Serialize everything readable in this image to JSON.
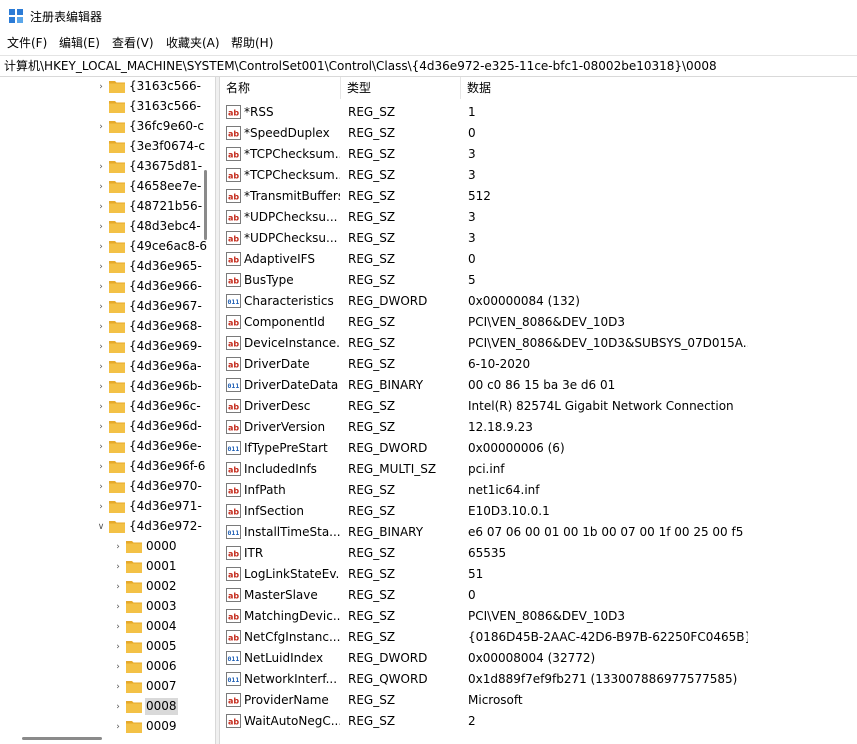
{
  "window": {
    "title": "注册表编辑器",
    "app_icon": "regedit-icon"
  },
  "menu": [
    "文件(F)",
    "编辑(E)",
    "查看(V)",
    "收藏夹(A)",
    "帮助(H)"
  ],
  "address": "计算机\\HKEY_LOCAL_MACHINE\\SYSTEM\\ControlSet001\\Control\\Class\\{4d36e972-e325-11ce-bfc1-08002be10318}\\0008",
  "tree": {
    "items": [
      {
        "label": "{3163c566-",
        "level": 1,
        "expander": "collapsed"
      },
      {
        "label": "{3163c566-",
        "level": 1,
        "expander": "none"
      },
      {
        "label": "{36fc9e60-c",
        "level": 1,
        "expander": "collapsed"
      },
      {
        "label": "{3e3f0674-c",
        "level": 1,
        "expander": "none"
      },
      {
        "label": "{43675d81-",
        "level": 1,
        "expander": "collapsed"
      },
      {
        "label": "{4658ee7e-",
        "level": 1,
        "expander": "collapsed"
      },
      {
        "label": "{48721b56-",
        "level": 1,
        "expander": "collapsed"
      },
      {
        "label": "{48d3ebc4-",
        "level": 1,
        "expander": "collapsed"
      },
      {
        "label": "{49ce6ac8-6",
        "level": 1,
        "expander": "collapsed"
      },
      {
        "label": "{4d36e965-",
        "level": 1,
        "expander": "collapsed"
      },
      {
        "label": "{4d36e966-",
        "level": 1,
        "expander": "collapsed"
      },
      {
        "label": "{4d36e967-",
        "level": 1,
        "expander": "collapsed"
      },
      {
        "label": "{4d36e968-",
        "level": 1,
        "expander": "collapsed"
      },
      {
        "label": "{4d36e969-",
        "level": 1,
        "expander": "collapsed"
      },
      {
        "label": "{4d36e96a-",
        "level": 1,
        "expander": "collapsed"
      },
      {
        "label": "{4d36e96b-",
        "level": 1,
        "expander": "collapsed"
      },
      {
        "label": "{4d36e96c-",
        "level": 1,
        "expander": "collapsed"
      },
      {
        "label": "{4d36e96d-",
        "level": 1,
        "expander": "collapsed"
      },
      {
        "label": "{4d36e96e-",
        "level": 1,
        "expander": "collapsed"
      },
      {
        "label": "{4d36e96f-6",
        "level": 1,
        "expander": "collapsed"
      },
      {
        "label": "{4d36e970-",
        "level": 1,
        "expander": "collapsed"
      },
      {
        "label": "{4d36e971-",
        "level": 1,
        "expander": "collapsed"
      },
      {
        "label": "{4d36e972-",
        "level": 1,
        "expander": "expanded"
      },
      {
        "label": "0000",
        "level": 2,
        "expander": "collapsed"
      },
      {
        "label": "0001",
        "level": 2,
        "expander": "collapsed"
      },
      {
        "label": "0002",
        "level": 2,
        "expander": "collapsed"
      },
      {
        "label": "0003",
        "level": 2,
        "expander": "collapsed"
      },
      {
        "label": "0004",
        "level": 2,
        "expander": "collapsed"
      },
      {
        "label": "0005",
        "level": 2,
        "expander": "collapsed"
      },
      {
        "label": "0006",
        "level": 2,
        "expander": "collapsed"
      },
      {
        "label": "0007",
        "level": 2,
        "expander": "collapsed"
      },
      {
        "label": "0008",
        "level": 2,
        "expander": "collapsed",
        "selected": true
      },
      {
        "label": "0009",
        "level": 2,
        "expander": "collapsed"
      }
    ]
  },
  "list": {
    "headers": {
      "name": "名称",
      "type": "类型",
      "data": "数据"
    },
    "rows": [
      {
        "icon": "string-value-icon",
        "name": "*RSS",
        "type": "REG_SZ",
        "data": "1"
      },
      {
        "icon": "string-value-icon",
        "name": "*SpeedDuplex",
        "type": "REG_SZ",
        "data": "0"
      },
      {
        "icon": "string-value-icon",
        "name": "*TCPChecksum...",
        "type": "REG_SZ",
        "data": "3"
      },
      {
        "icon": "string-value-icon",
        "name": "*TCPChecksum...",
        "type": "REG_SZ",
        "data": "3"
      },
      {
        "icon": "string-value-icon",
        "name": "*TransmitBuffers",
        "type": "REG_SZ",
        "data": "512"
      },
      {
        "icon": "string-value-icon",
        "name": "*UDPChecksu...",
        "type": "REG_SZ",
        "data": "3"
      },
      {
        "icon": "string-value-icon",
        "name": "*UDPChecksu...",
        "type": "REG_SZ",
        "data": "3"
      },
      {
        "icon": "string-value-icon",
        "name": "AdaptiveIFS",
        "type": "REG_SZ",
        "data": "0"
      },
      {
        "icon": "string-value-icon",
        "name": "BusType",
        "type": "REG_SZ",
        "data": "5"
      },
      {
        "icon": "binary-value-icon",
        "name": "Characteristics",
        "type": "REG_DWORD",
        "data": "0x00000084 (132)"
      },
      {
        "icon": "string-value-icon",
        "name": "ComponentId",
        "type": "REG_SZ",
        "data": "PCI\\VEN_8086&DEV_10D3"
      },
      {
        "icon": "string-value-icon",
        "name": "DeviceInstance...",
        "type": "REG_SZ",
        "data": "PCI\\VEN_8086&DEV_10D3&SUBSYS_07D015A..."
      },
      {
        "icon": "string-value-icon",
        "name": "DriverDate",
        "type": "REG_SZ",
        "data": "6-10-2020"
      },
      {
        "icon": "binary-value-icon",
        "name": "DriverDateData",
        "type": "REG_BINARY",
        "data": "00 c0 86 15 ba 3e d6 01"
      },
      {
        "icon": "string-value-icon",
        "name": "DriverDesc",
        "type": "REG_SZ",
        "data": "Intel(R) 82574L Gigabit Network Connection"
      },
      {
        "icon": "string-value-icon",
        "name": "DriverVersion",
        "type": "REG_SZ",
        "data": "12.18.9.23"
      },
      {
        "icon": "binary-value-icon",
        "name": "IfTypePreStart",
        "type": "REG_DWORD",
        "data": "0x00000006 (6)"
      },
      {
        "icon": "string-value-icon",
        "name": "IncludedInfs",
        "type": "REG_MULTI_SZ",
        "data": "pci.inf"
      },
      {
        "icon": "string-value-icon",
        "name": "InfPath",
        "type": "REG_SZ",
        "data": "net1ic64.inf"
      },
      {
        "icon": "string-value-icon",
        "name": "InfSection",
        "type": "REG_SZ",
        "data": "E10D3.10.0.1"
      },
      {
        "icon": "binary-value-icon",
        "name": "InstallTimeSta...",
        "type": "REG_BINARY",
        "data": "e6 07 06 00 01 00 1b 00 07 00 1f 00 25 00 f5 ..."
      },
      {
        "icon": "string-value-icon",
        "name": "ITR",
        "type": "REG_SZ",
        "data": "65535"
      },
      {
        "icon": "string-value-icon",
        "name": "LogLinkStateEv...",
        "type": "REG_SZ",
        "data": "51"
      },
      {
        "icon": "string-value-icon",
        "name": "MasterSlave",
        "type": "REG_SZ",
        "data": "0"
      },
      {
        "icon": "string-value-icon",
        "name": "MatchingDevic...",
        "type": "REG_SZ",
        "data": "PCI\\VEN_8086&DEV_10D3"
      },
      {
        "icon": "string-value-icon",
        "name": "NetCfgInstanc...",
        "type": "REG_SZ",
        "data": "{0186D45B-2AAC-42D6-B97B-62250FC0465B}"
      },
      {
        "icon": "binary-value-icon",
        "name": "NetLuidIndex",
        "type": "REG_DWORD",
        "data": "0x00008004 (32772)"
      },
      {
        "icon": "binary-value-icon",
        "name": "NetworkInterf...",
        "type": "REG_QWORD",
        "data": "0x1d889f7ef9fb271 (133007886977577585)"
      },
      {
        "icon": "string-value-icon",
        "name": "ProviderName",
        "type": "REG_SZ",
        "data": "Microsoft"
      },
      {
        "icon": "string-value-icon",
        "name": "WaitAutoNegC...",
        "type": "REG_SZ",
        "data": "2"
      }
    ]
  },
  "colors": {
    "folder": "#f3c146",
    "string_icon_red": "#c42b1c",
    "binary_icon_blue": "#1f5fb5",
    "selection": "#d9d9d9"
  }
}
